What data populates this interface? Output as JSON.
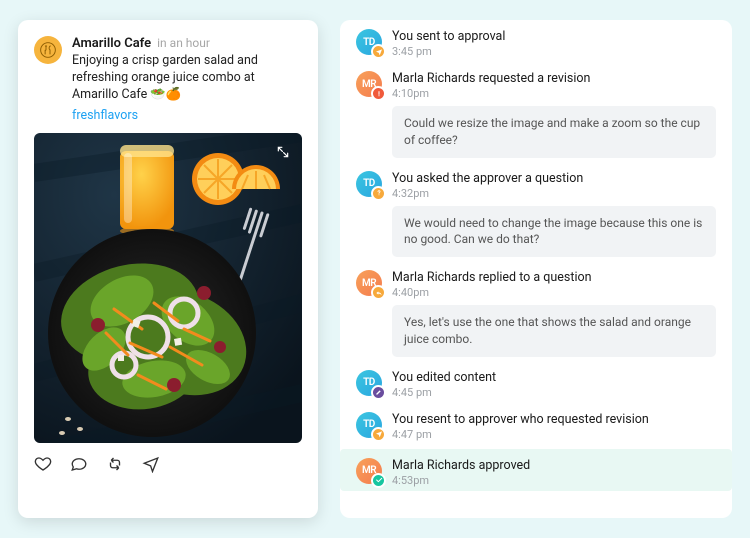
{
  "post": {
    "author": "Amarillo Cafe",
    "time_label": "in an hour",
    "body": "Enjoying a crisp garden salad and refreshing orange juice combo at Amarillo Cafe 🥗🍊",
    "hashtag": "freshflavors",
    "image_alt": "Salad bowl with orange juice and orange slices on dark table"
  },
  "activity": [
    {
      "avatar": "TD",
      "badge": "send",
      "title": "You sent to approval",
      "time": "3:45 pm"
    },
    {
      "avatar": "MR",
      "badge": "alert",
      "title": "Marla Richards requested a revision",
      "time": "4:10pm",
      "note": "Could we resize the image and make a zoom so the cup of coffee?"
    },
    {
      "avatar": "TD",
      "badge": "question",
      "title": "You asked the approver a question",
      "time": "4:32pm",
      "note": "We would need to change the image because this one is no good. Can we do that?"
    },
    {
      "avatar": "MR",
      "badge": "reply",
      "title": "Marla Richards replied to a question",
      "time": "4:40pm",
      "note": "Yes, let's use the one that shows the salad and orange juice combo."
    },
    {
      "avatar": "TD",
      "badge": "edit",
      "title": "You edited content",
      "time": "4:45 pm"
    },
    {
      "avatar": "TD",
      "badge": "resend",
      "title": "You resent to approver who requested revision",
      "time": "4:47 pm"
    },
    {
      "avatar": "MR",
      "badge": "approve",
      "title": "Marla Richards approved",
      "time": "4:53pm",
      "highlight": true
    }
  ]
}
